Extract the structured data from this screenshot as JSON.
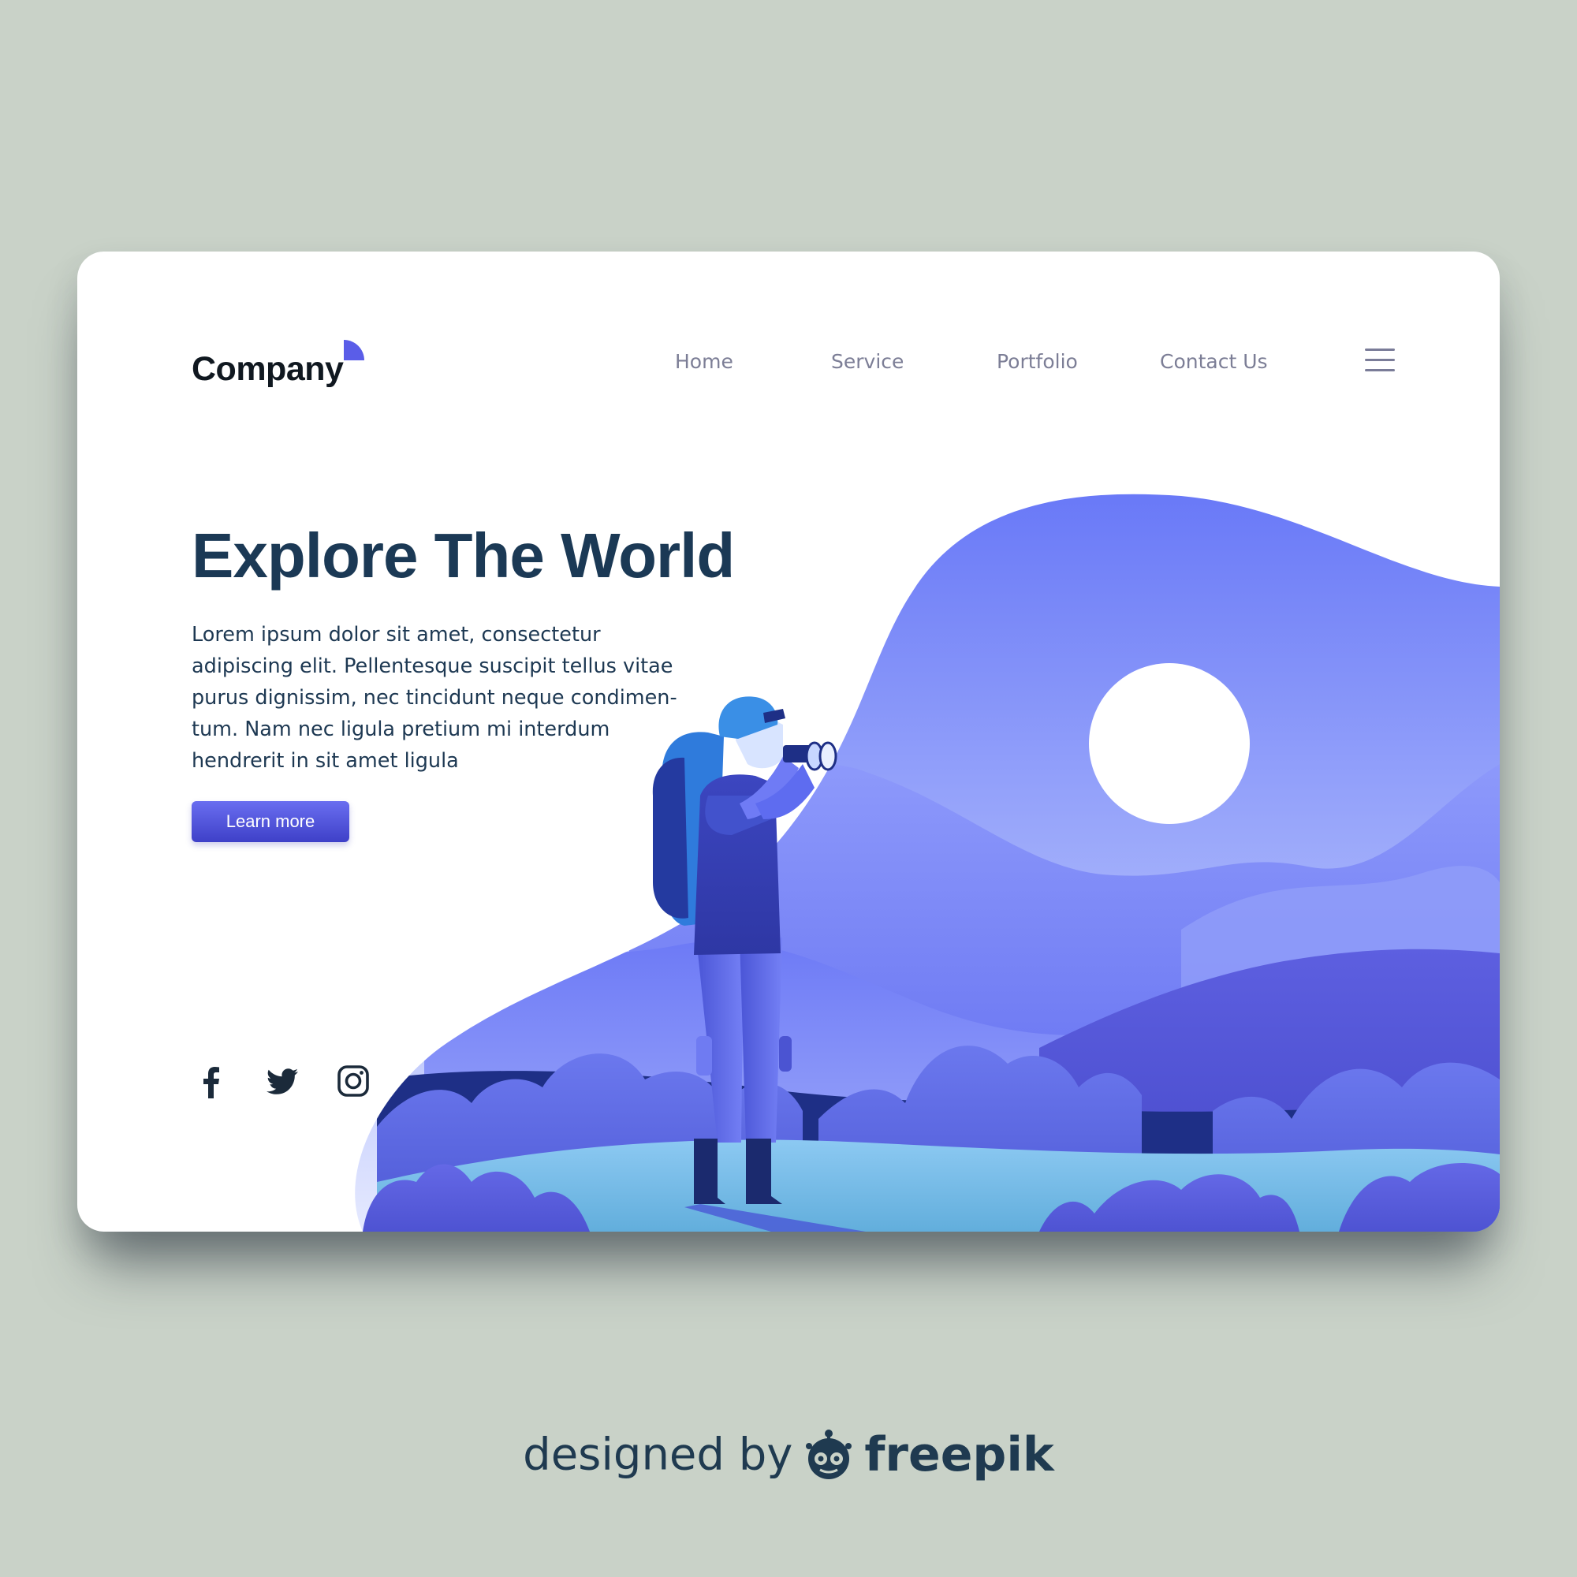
{
  "header": {
    "logo_text": "Company",
    "nav": [
      {
        "label": "Home"
      },
      {
        "label": "Service"
      },
      {
        "label": "Portfolio"
      },
      {
        "label": "Contact Us"
      }
    ],
    "menu_icon": "hamburger-menu-icon"
  },
  "hero": {
    "title": "Explore The World",
    "body": "Lorem ipsum dolor sit amet, consectetur adipiscing elit. Pellentesque suscipit tellus vitae purus dignissim, nec tincidunt neque condimen-tum. Nam nec ligula pretium mi interdum hendrerit in sit amet ligula",
    "cta_label": "Learn more"
  },
  "social": [
    {
      "icon": "facebook-icon"
    },
    {
      "icon": "twitter-icon"
    },
    {
      "icon": "instagram-icon"
    }
  ],
  "credit": {
    "prefix": "designed by",
    "brand": "freepik"
  },
  "colors": {
    "page_bg": "#c9d2c8",
    "card_bg": "#ffffff",
    "title": "#1b3955",
    "nav_text": "#7c7e96",
    "accent": "#5a5de8",
    "sky_top": "#6a78f8",
    "sky_bottom": "#e6ebff",
    "mountain": "#7380f5",
    "ground": "#7ec0ea",
    "bush_dark": "#1e2f86"
  }
}
